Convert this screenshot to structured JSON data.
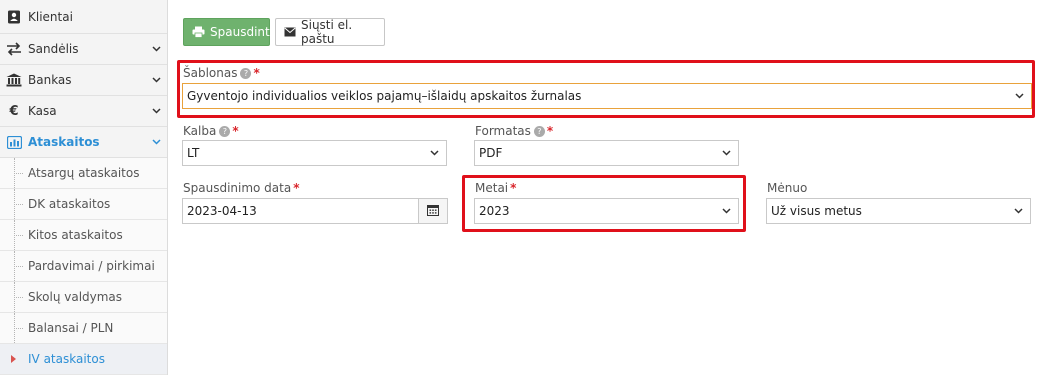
{
  "sidebar": {
    "items": [
      {
        "label": "Klientai",
        "icon": "contact-card-icon",
        "has_chevron": false
      },
      {
        "label": "Sandėlis",
        "icon": "exchange-arrows-icon",
        "has_chevron": true
      },
      {
        "label": "Bankas",
        "icon": "bank-icon",
        "has_chevron": true
      },
      {
        "label": "Kasa",
        "icon": "euro-icon",
        "has_chevron": true
      },
      {
        "label": "Ataskaitos",
        "icon": "chart-icon",
        "has_chevron": true,
        "active": true
      }
    ],
    "subitems": [
      {
        "label": "Atsargų ataskaitos"
      },
      {
        "label": "DK ataskaitos"
      },
      {
        "label": "Kitos ataskaitos"
      },
      {
        "label": "Pardavimai / pirkimai"
      },
      {
        "label": "Skolų valdymas"
      },
      {
        "label": "Balansai / PLN"
      },
      {
        "label": "IV ataskaitos",
        "active": true
      }
    ]
  },
  "toolbar": {
    "print_label": "Spausdinti",
    "email_label": "Siųsti el. paštu"
  },
  "form": {
    "template": {
      "label": "Šablonas",
      "value": "Gyventojo individualios veiklos pajamų–išlaidų apskaitos žurnalas"
    },
    "language": {
      "label": "Kalba",
      "value": "LT"
    },
    "format": {
      "label": "Formatas",
      "value": "PDF"
    },
    "print_date": {
      "label": "Spausdinimo data",
      "value": "2023-04-13"
    },
    "year": {
      "label": "Metai",
      "value": "2023"
    },
    "month": {
      "label": "Mėnuo",
      "value": "Už visus metus"
    }
  },
  "colors": {
    "accent": "#2d8fd5",
    "print_button": "#6fb26e",
    "highlight": "#e0101a",
    "required": "#d9262c"
  }
}
